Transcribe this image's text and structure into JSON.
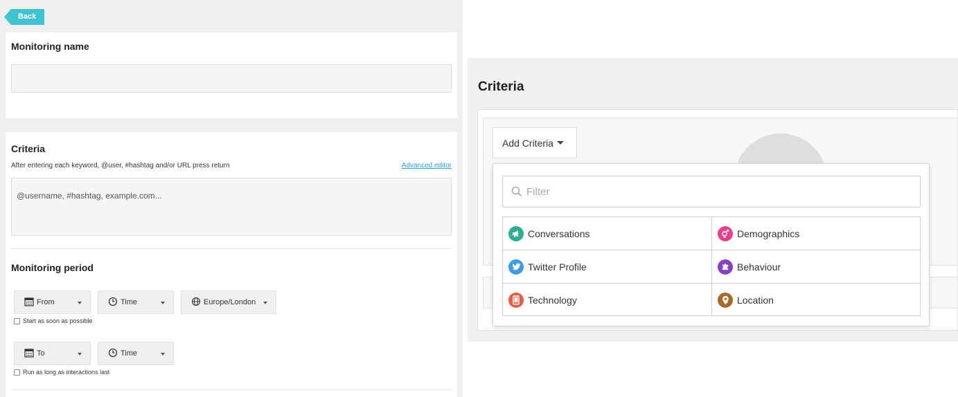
{
  "left": {
    "back_label": "Back",
    "monitoring_name_title": "Monitoring name",
    "monitoring_name_value": "",
    "criteria_title": "Criteria",
    "criteria_help": "After entering each keyword, @user, #hashtag and/or URL press return",
    "advanced_editor": "Advanced editor",
    "criteria_placeholder": "@username, #hashtag, example.com...",
    "period_title": "Monitoring period",
    "from_label": "From",
    "time_label_1": "Time",
    "timezone_label": "Europe/London",
    "start_asap": "Start as soon as possible",
    "to_label": "To",
    "time_label_2": "Time",
    "run_long": "Run as long as interactions last"
  },
  "right": {
    "criteria_title": "Criteria",
    "add_criteria": "Add Criteria",
    "filter_placeholder": "Filter",
    "categories": [
      {
        "label": "Conversations",
        "icon": "megaphone-icon",
        "color": "#2baf93"
      },
      {
        "label": "Demographics",
        "icon": "gender-icon",
        "color": "#e83f8d"
      },
      {
        "label": "Twitter Profile",
        "icon": "twitter-icon",
        "color": "#3d9be9"
      },
      {
        "label": "Behaviour",
        "icon": "puzzle-icon",
        "color": "#8a3fc7"
      },
      {
        "label": "Technology",
        "icon": "tablet-icon",
        "color": "#ec5a42"
      },
      {
        "label": "Location",
        "icon": "map-pin-icon",
        "color": "#a8692a"
      }
    ]
  },
  "colors": {
    "back_button": "#3fc4cf",
    "link": "#2a9fd6"
  }
}
